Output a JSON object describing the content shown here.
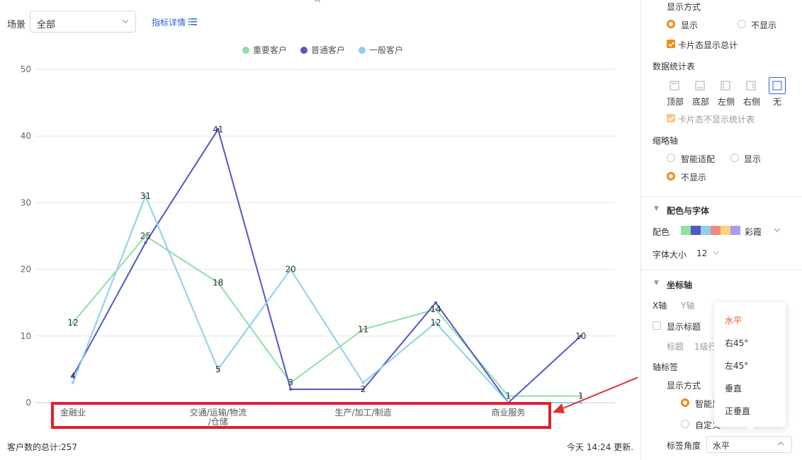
{
  "toolbar": {
    "scene_label": "场景",
    "scene_value": "全部",
    "metric_link": "指标详情"
  },
  "footer": {
    "total": "客户数的总计:257",
    "update": "今天 14:24 更新."
  },
  "chart_data": {
    "type": "line",
    "categories": [
      "金融业",
      "",
      "交通/运输/物流/仓储",
      "",
      "生产/加工/制造",
      "",
      "商业服务",
      ""
    ],
    "x_tick_labels": [
      {
        "index": 0,
        "lines": [
          "金融业"
        ]
      },
      {
        "index": 2,
        "lines": [
          "交通/运输/物流",
          "/仓储"
        ]
      },
      {
        "index": 4,
        "lines": [
          "生产/加工/制造"
        ]
      },
      {
        "index": 6,
        "lines": [
          "商业服务"
        ]
      }
    ],
    "series": [
      {
        "name": "重要客户",
        "color": "#8ee0a7",
        "values": [
          12,
          25,
          18,
          3,
          11,
          14,
          1,
          1
        ]
      },
      {
        "name": "普通客户",
        "color": "#5356c8",
        "values": [
          4,
          24,
          41,
          2,
          2,
          15,
          0,
          10
        ]
      },
      {
        "name": "一般客户",
        "color": "#8dd0ec",
        "values": [
          3,
          31,
          5,
          20,
          3,
          12,
          0,
          0
        ]
      }
    ],
    "data_labels": [
      {
        "index": 0,
        "value": 12
      },
      {
        "index": 0,
        "value": 4
      },
      {
        "index": 1,
        "value": 31
      },
      {
        "index": 1,
        "value": 25
      },
      {
        "index": 2,
        "value": 41
      },
      {
        "index": 2,
        "value": 18
      },
      {
        "index": 2,
        "value": 5
      },
      {
        "index": 3,
        "value": 20
      },
      {
        "index": 3,
        "value": 3
      },
      {
        "index": 4,
        "value": 11
      },
      {
        "index": 4,
        "value": 2
      },
      {
        "index": 5,
        "value": 14
      },
      {
        "index": 5,
        "value": 12
      },
      {
        "index": 6,
        "value": 1
      },
      {
        "index": 7,
        "value": 10
      },
      {
        "index": 7,
        "value": 1
      }
    ],
    "ylim": [
      0,
      50
    ],
    "y_ticks": [
      0,
      10,
      20,
      30,
      40,
      50
    ],
    "grid": true,
    "legend_position": "top-center",
    "highlight_color": "#e0202a",
    "annotation_arrow_color": "#e03030"
  },
  "panel": {
    "display_mode": "显示方式",
    "show": "显示",
    "hide": "不显示",
    "card_total": "卡片态显示总计",
    "data_table": "数据统计表",
    "positions": [
      "顶部",
      "底部",
      "左侧",
      "右侧",
      "无"
    ],
    "card_no_table": "卡片态不显示统计表",
    "thumbnail_axis": "缩略轴",
    "smart_fit": "智能适配",
    "thumb_show": "显示",
    "thumb_hide": "不显示",
    "color_font_section": "配色与字体",
    "color_label": "配色",
    "palette_name": "彩霞",
    "palette_colors": [
      "#8ee0a7",
      "#5356c8",
      "#8dd0ec",
      "#f08a7e",
      "#f9d57a",
      "#a89ef0"
    ],
    "font_size_label": "字体大小",
    "font_size_value": "12",
    "axis_section": "坐标轴",
    "x_axis_tab": "X轴",
    "y_axis_tab": "Y轴",
    "show_title": "显示标题",
    "title_label": "标题",
    "title_rows": "1级行",
    "axis_labels": "轴标签",
    "label_display_mode": "显示方式",
    "label_smart": "智能显",
    "label_custom": "自定义",
    "label_angle": "标签角度",
    "label_angle_value": "水平"
  },
  "angle_dropdown": {
    "options": [
      "水平",
      "右45°",
      "左45°",
      "垂直",
      "正垂直"
    ],
    "selected": "水平"
  }
}
